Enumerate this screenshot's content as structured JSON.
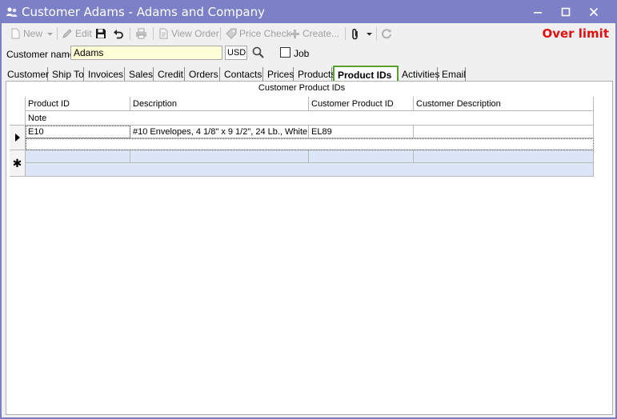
{
  "window": {
    "title": "Customer Adams - Adams and Company"
  },
  "toolbar": {
    "new_label": "New",
    "edit_label": "Edit",
    "view_order_label": "View Order",
    "price_check_label": "Price Check",
    "create_label": "Create...",
    "status": "Over limit",
    "status_color": "#e01010"
  },
  "customer": {
    "label": "Customer name",
    "value": "Adams",
    "currency": "USD",
    "job_label": "Job",
    "job_checked": false
  },
  "tabs": [
    {
      "label": "Customer"
    },
    {
      "label": "Ship To"
    },
    {
      "label": "Invoices"
    },
    {
      "label": "Sales"
    },
    {
      "label": "Credit"
    },
    {
      "label": "Orders"
    },
    {
      "label": "Contacts"
    },
    {
      "label": "Prices"
    },
    {
      "label": "Products"
    },
    {
      "label": "Product IDs",
      "active": true
    },
    {
      "label": "Activities"
    },
    {
      "label": "Email"
    }
  ],
  "grid": {
    "title": "Customer Product IDs",
    "columns": [
      "Product ID",
      "Description",
      "Customer Product ID",
      "Customer Description"
    ],
    "note_header": "Note",
    "rows": [
      {
        "product_id": "E10",
        "description": "#10 Envelopes, 4 1/8\" x 9 1/2\", 24 Lb., White",
        "customer_product_id": "EL89",
        "customer_description": "",
        "note": ""
      }
    ]
  },
  "colors": {
    "titlebar": "#7c80c6",
    "active_tab_border": "#5aa02c",
    "customer_field_bg": "#ffffd8",
    "new_row_bg": "#dce6f8"
  }
}
